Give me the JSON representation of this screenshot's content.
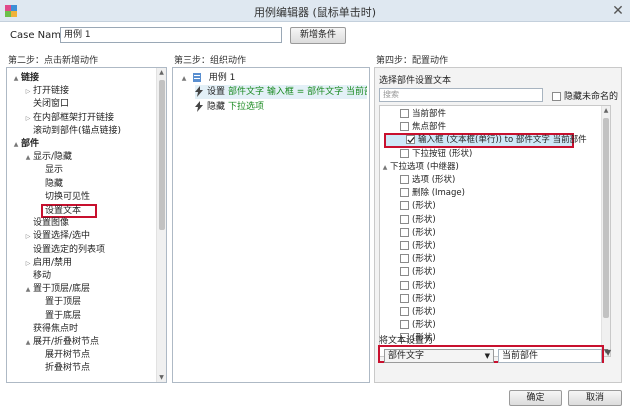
{
  "window": {
    "title": "用例编辑器 (鼠标单击时)",
    "close_glyph": "✕"
  },
  "case_name": {
    "label": "Case Name",
    "value": "用例 1",
    "add_condition": "新增条件"
  },
  "steps": {
    "step2": "第二步：点击新增动作",
    "step3": "第三步：组织动作",
    "step4": "第四步：配置动作"
  },
  "actions_tree": [
    {
      "label": "链接",
      "toggle": "▲",
      "bold": true
    },
    {
      "label": "打开链接",
      "toggle": "▷"
    },
    {
      "label": "关闭窗口",
      "toggle": ""
    },
    {
      "label": "在内部框架打开链接",
      "toggle": "▷"
    },
    {
      "label": "滚动到部件(锚点链接)",
      "toggle": ""
    },
    {
      "label": "部件",
      "toggle": "▲",
      "bold": true
    },
    {
      "label": "显示/隐藏",
      "toggle": "▲"
    },
    {
      "label": "显示",
      "toggle": ""
    },
    {
      "label": "隐藏",
      "toggle": ""
    },
    {
      "label": "切换可见性",
      "toggle": ""
    },
    {
      "label": "设置文本",
      "toggle": "",
      "highlight": true
    },
    {
      "label": "设置图像",
      "toggle": ""
    },
    {
      "label": "设置选择/选中",
      "toggle": "▷"
    },
    {
      "label": "设置选定的列表项",
      "toggle": ""
    },
    {
      "label": "启用/禁用",
      "toggle": "▷"
    },
    {
      "label": "移动",
      "toggle": ""
    },
    {
      "label": "置于顶层/底层",
      "toggle": "▲"
    },
    {
      "label": "置于顶层",
      "toggle": ""
    },
    {
      "label": "置于底层",
      "toggle": ""
    },
    {
      "label": "获得焦点时",
      "toggle": ""
    },
    {
      "label": "展开/折叠树节点",
      "toggle": "▲"
    },
    {
      "label": "展开树节点",
      "toggle": ""
    },
    {
      "label": "折叠树节点",
      "toggle": ""
    }
  ],
  "organize": {
    "case_label": "用例 1",
    "actions": [
      {
        "verb": "设置",
        "detail": "部件文字 输入框 = 部件文字 当前部件",
        "selected": true
      },
      {
        "verb": "隐藏",
        "detail": "下拉选项",
        "selected": false
      }
    ]
  },
  "configure": {
    "header": "选择部件设置文本",
    "search_placeholder": "搜索",
    "hide_unnamed_label": "隐藏未命名的",
    "widgets": [
      {
        "label": "当前部件",
        "toggle": "",
        "checked": false
      },
      {
        "label": "焦点部件",
        "toggle": "",
        "checked": false
      },
      {
        "label": "输入框 (文本框(单行)) to 部件文字 当前部件",
        "toggle": "",
        "checked": true,
        "highlight": true
      },
      {
        "label": "下拉按钮 (形状)",
        "toggle": "",
        "checked": false
      },
      {
        "label": "下拉选项 (中继器)",
        "toggle": "▲",
        "checked": null
      },
      {
        "label": "选项 (形状)",
        "toggle": "",
        "checked": false
      },
      {
        "label": "删除 (Image)",
        "toggle": "",
        "checked": false
      },
      {
        "label": "(形状)",
        "toggle": "",
        "checked": false
      },
      {
        "label": "(形状)",
        "toggle": "",
        "checked": false
      },
      {
        "label": "(形状)",
        "toggle": "",
        "checked": false
      },
      {
        "label": "(形状)",
        "toggle": "",
        "checked": false
      },
      {
        "label": "(形状)",
        "toggle": "",
        "checked": false
      },
      {
        "label": "(形状)",
        "toggle": "",
        "checked": false
      },
      {
        "label": "(形状)",
        "toggle": "",
        "checked": false
      },
      {
        "label": "(形状)",
        "toggle": "",
        "checked": false
      },
      {
        "label": "(形状)",
        "toggle": "",
        "checked": false
      },
      {
        "label": "(形状)",
        "toggle": "",
        "checked": false
      },
      {
        "label": "(形状)",
        "toggle": "",
        "checked": false
      }
    ],
    "set_text_label": "将文本设置为",
    "set_type": "部件文字",
    "set_value": "当前部件"
  },
  "buttons": {
    "ok": "确定",
    "cancel": "取消"
  },
  "colors": {
    "highlight_border": "#c8102e",
    "title_bar": "#dfe8f1",
    "selection": "#cfe8f7",
    "link_text": "#1a8a20"
  }
}
